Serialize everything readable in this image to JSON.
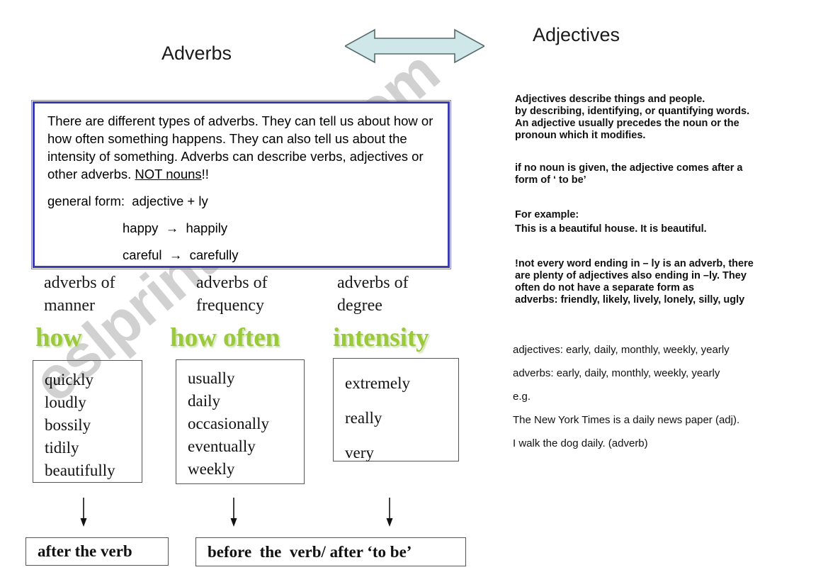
{
  "headings": {
    "adverbs": "Adverbs",
    "adjectives": "Adjectives"
  },
  "arrow": {
    "name": "double-headed-arrow",
    "fill": "#cfe7e8",
    "stroke": "#556b6b"
  },
  "adverb_info_box": {
    "border_color": "#3b3bb0",
    "paragraph_part1": "There are different types of adverbs. They can tell us about how or how often something happens. They can also tell us about the intensity of something. Adverbs can describe verbs, adjectives or other adverbs. ",
    "paragraph_underlined": "NOT nouns",
    "paragraph_part2": "!!",
    "general_form": "general form:  adjective + ly",
    "example_1": "happy  →  happily",
    "example_2": "careful  →  carefully"
  },
  "columns": [
    {
      "heading": "adverbs of\nmanner",
      "green_label": "how",
      "words": [
        "quickly",
        "loudly",
        "bossily",
        "tidily",
        "beautifully"
      ]
    },
    {
      "heading": "adverbs of\nfrequency",
      "green_label": "how often",
      "words": [
        "usually",
        "daily",
        "occasionally",
        "eventually",
        "weekly"
      ]
    },
    {
      "heading": "adverbs of\ndegree",
      "green_label": "intensity",
      "words": [
        "extremely",
        "really",
        "very"
      ]
    }
  ],
  "green_color": "#9ac93a",
  "results": {
    "after_the_verb": "after the verb",
    "before_the_verb": "before  the  verb/ after ‘to be’"
  },
  "adjectives_panel": {
    "block_1": "Adjectives describe things and people.\nby describing, identifying, or quantifying words.\nAn adjective usually precedes the noun or the\npronoun which it modifies.",
    "block_2": "if no noun is given, the adjective comes after a\nform of ‘ to be’",
    "block_3": "For example:\nThis is a beautiful house. It is beautiful.",
    "block_4": "!not every word ending in – ly is an adverb, there\nare plenty of adjectives also ending in –ly. They\noften do not have a separate form as\nadverbs:   friendly, likely, lively, lonely, silly, ugly",
    "line_1": "adjectives: early, daily, monthly, weekly, yearly",
    "line_2": "adverbs: early, daily, monthly, weekly, yearly",
    "line_3": "e.g.",
    "line_4": "The New York Times is a daily news paper (adj).",
    "line_5": "I walk the dog daily. (adverb)"
  },
  "watermark": {
    "text": "eslprintables.com"
  }
}
